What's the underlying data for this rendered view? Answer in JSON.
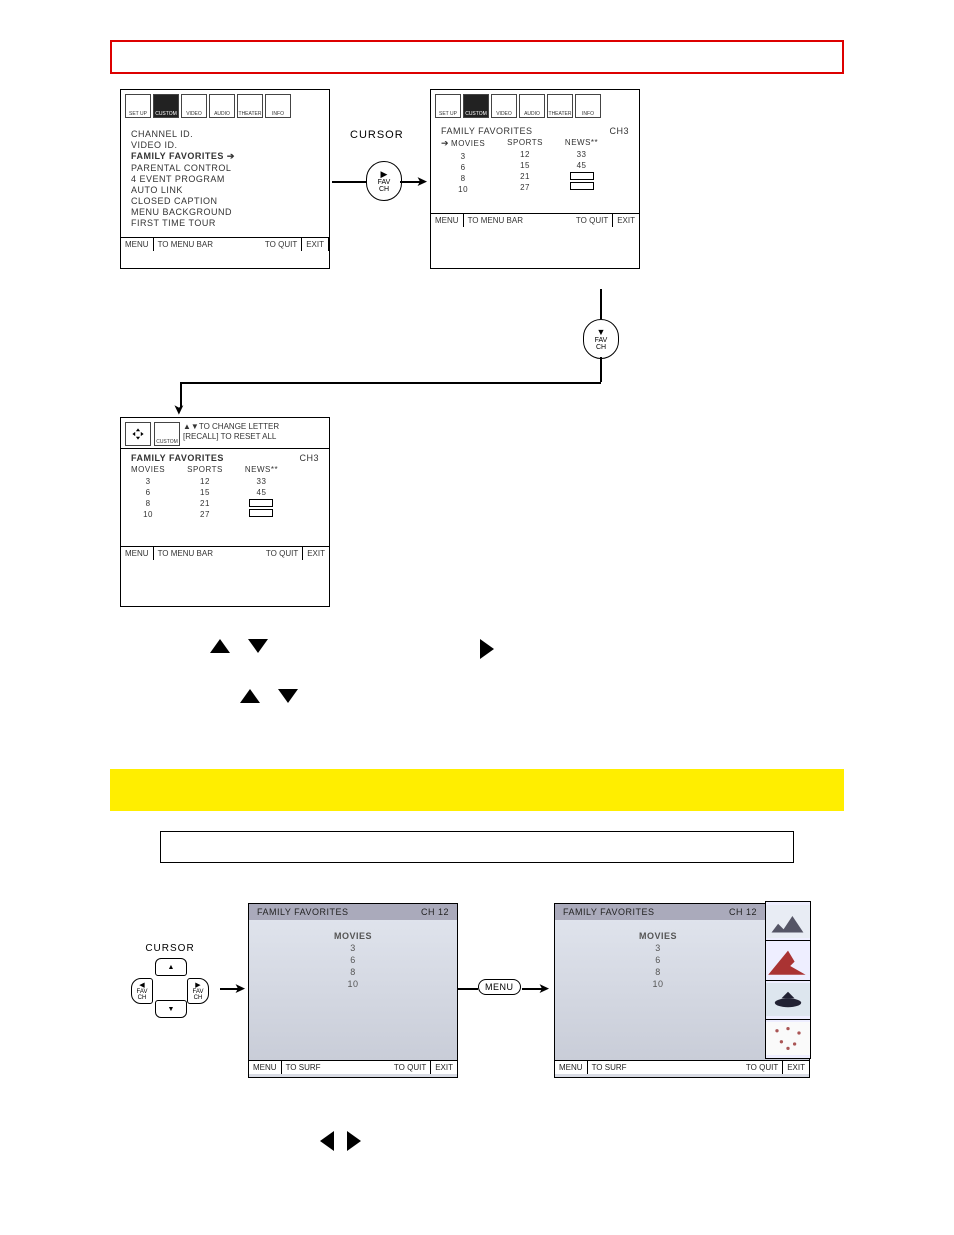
{
  "iconbar": {
    "labels": [
      "SET UP",
      "CUSTOM",
      "VIDEO",
      "AUDIO",
      "THEATER",
      "INFO"
    ]
  },
  "screen1": {
    "items": [
      "CHANNEL ID.",
      "VIDEO ID.",
      "FAMILY FAVORITES",
      "PARENTAL CONTROL",
      "4 EVENT PROGRAM",
      "AUTO LINK",
      "CLOSED CAPTION",
      "MENU BACKGROUND",
      "FIRST TIME TOUR"
    ],
    "selected_index": 2
  },
  "screen2": {
    "title": "FAMILY FAVORITES",
    "channel": "CH3",
    "columns": [
      "MOVIES",
      "SPORTS",
      "NEWS**"
    ],
    "rows": [
      [
        "3",
        "12",
        "33"
      ],
      [
        "6",
        "15",
        "45"
      ],
      [
        "8",
        "21",
        ""
      ],
      [
        "10",
        "27",
        ""
      ]
    ],
    "selected_col": 0
  },
  "screen3": {
    "hint1": "TO CHANGE LETTER",
    "hint2": "[RECALL] TO RESET ALL",
    "title": "FAMILY FAVORITES",
    "channel": "CH3",
    "columns": [
      "MOVIES",
      "SPORTS",
      "NEWS**"
    ],
    "rows": [
      [
        "3",
        "12",
        "33"
      ],
      [
        "6",
        "15",
        "45"
      ],
      [
        "8",
        "21",
        ""
      ],
      [
        "10",
        "27",
        ""
      ]
    ]
  },
  "footer": {
    "menu": "MENU",
    "to_menu_bar": "TO MENU BAR",
    "to_quit": "TO QUIT",
    "to_surf": "TO SURF",
    "exit": "EXIT"
  },
  "cursor_label": "CURSOR",
  "favch": {
    "fav": "FAV",
    "ch": "CH"
  },
  "surf1": {
    "title": "FAMILY FAVORITES",
    "channel": "CH 12",
    "heading": "MOVIES",
    "values": [
      "3",
      "6",
      "8",
      "10"
    ]
  },
  "surf2": {
    "title": "FAMILY FAVORITES",
    "channel": "CH 12",
    "heading": "MOVIES",
    "values": [
      "3",
      "6",
      "8",
      "10"
    ]
  },
  "menu_pill": "MENU"
}
